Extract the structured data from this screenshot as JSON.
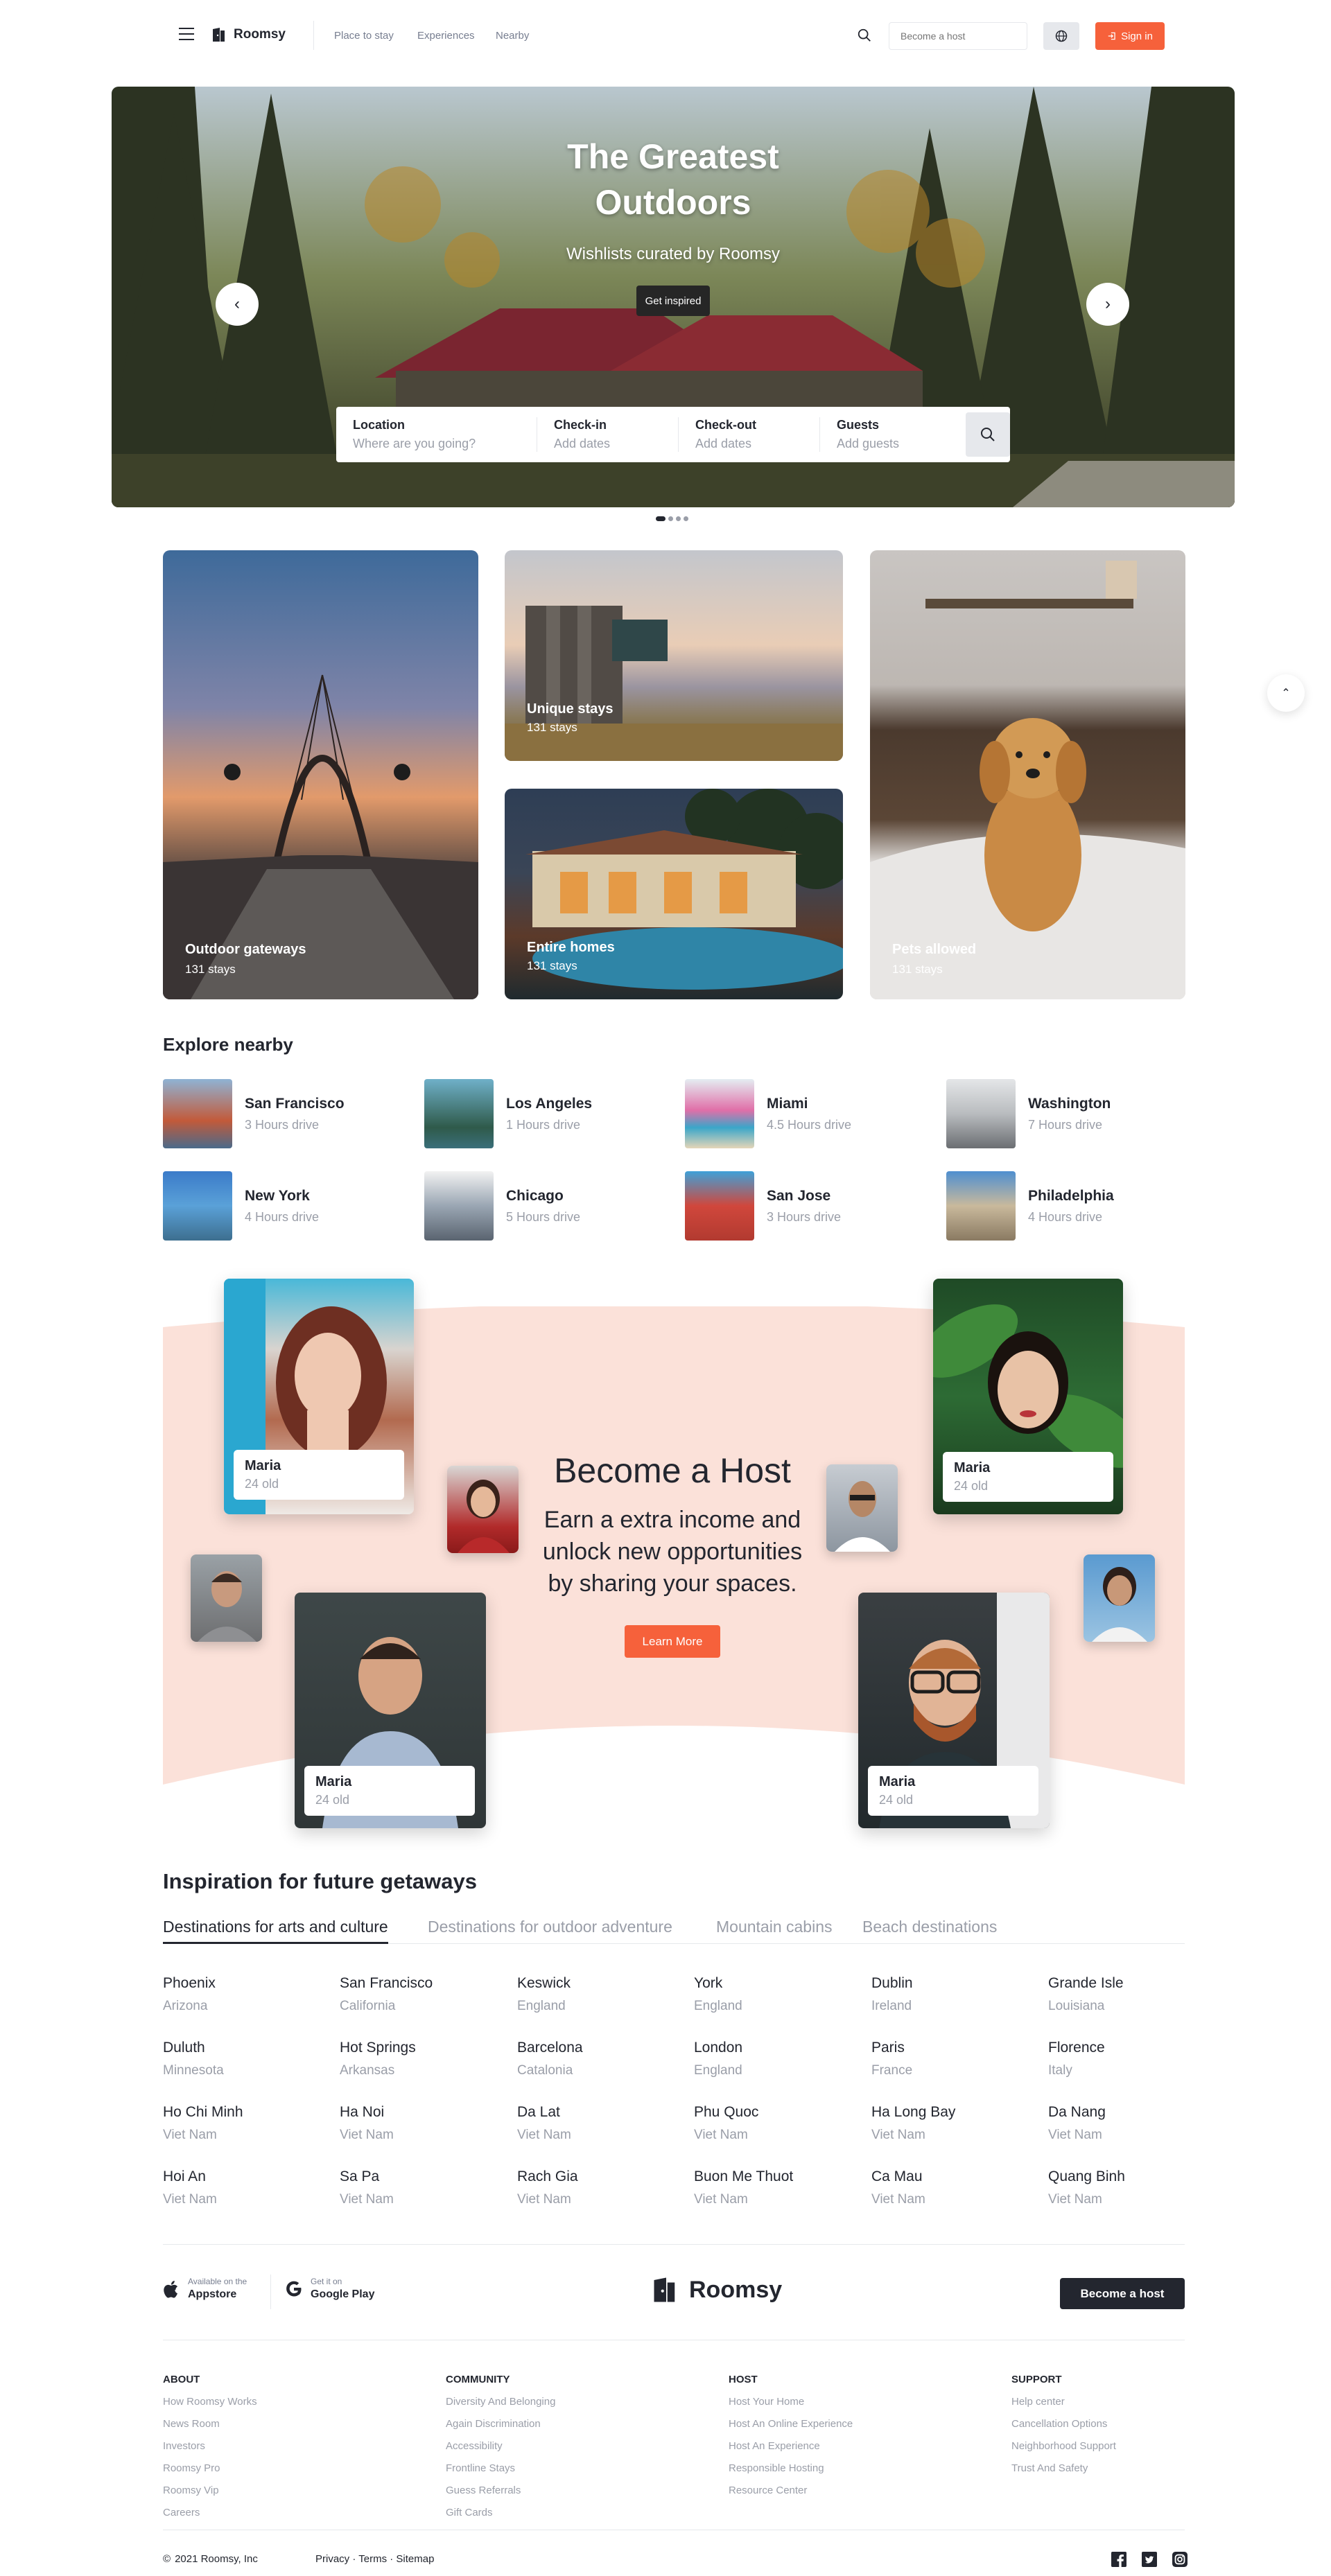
{
  "header": {
    "brand": "Roomsy",
    "nav": [
      "Place to stay",
      "Experiences",
      "Nearby"
    ],
    "host_placeholder": "Become a host",
    "signin_label": "Sign in",
    "accent": "#f6613b"
  },
  "hero": {
    "title_line1": "The Greatest",
    "title_line2": "Outdoors",
    "subtitle": "Wishlists curated by Roomsy",
    "cta": "Get inspired",
    "active_slide": 1,
    "slide_count": 4,
    "search": {
      "location_label": "Location",
      "location_placeholder": "Where are you going?",
      "checkin_label": "Check-in",
      "checkin_placeholder": "Add dates",
      "checkout_label": "Check-out",
      "checkout_placeholder": "Add dates",
      "guests_label": "Guests",
      "guests_placeholder": "Add guests"
    }
  },
  "categories": [
    {
      "title": "Outdoor gateways",
      "count": "131 stays"
    },
    {
      "title": "Unique stays",
      "count": "131 stays"
    },
    {
      "title": "Entire homes",
      "count": "131 stays"
    },
    {
      "title": "Pets allowed",
      "count": "131 stays"
    }
  ],
  "explore": {
    "title": "Explore nearby",
    "items": [
      {
        "city": "San Francisco",
        "drive": "3 Hours drive"
      },
      {
        "city": "Los Angeles",
        "drive": "1 Hours drive"
      },
      {
        "city": "Miami",
        "drive": "4.5 Hours drive"
      },
      {
        "city": "Washington",
        "drive": "7 Hours drive"
      },
      {
        "city": "New York",
        "drive": "4 Hours drive"
      },
      {
        "city": "Chicago",
        "drive": "5 Hours drive"
      },
      {
        "city": "San Jose",
        "drive": "3 Hours drive"
      },
      {
        "city": "Philadelphia",
        "drive": "4 Hours drive"
      }
    ]
  },
  "host": {
    "title": "Become a Host",
    "text_line1": "Earn a extra income and",
    "text_line2": "unlock new opportunities",
    "text_line3": "by sharing your spaces.",
    "cta": "Learn More",
    "people": [
      {
        "name": "Maria",
        "age": "24 old"
      },
      {
        "name": "Maria",
        "age": "24 old"
      },
      {
        "name": "Maria",
        "age": "24 old"
      },
      {
        "name": "Maria",
        "age": "24 old"
      }
    ]
  },
  "inspiration": {
    "title": "Inspiration for future getaways",
    "tabs": [
      "Destinations for arts and culture",
      "Destinations for outdoor adventure",
      "Mountain cabins",
      "Beach destinations"
    ],
    "rows": [
      [
        {
          "c": "Phoenix",
          "r": "Arizona"
        },
        {
          "c": "San Francisco",
          "r": "California"
        },
        {
          "c": "Keswick",
          "r": "England"
        },
        {
          "c": "York",
          "r": "England"
        },
        {
          "c": "Dublin",
          "r": "Ireland"
        },
        {
          "c": "Grande Isle",
          "r": "Louisiana"
        }
      ],
      [
        {
          "c": "Duluth",
          "r": "Minnesota"
        },
        {
          "c": "Hot Springs",
          "r": "Arkansas"
        },
        {
          "c": "Barcelona",
          "r": "Catalonia"
        },
        {
          "c": "London",
          "r": "England"
        },
        {
          "c": "Paris",
          "r": "France"
        },
        {
          "c": "Florence",
          "r": "Italy"
        }
      ],
      [
        {
          "c": "Ho Chi Minh",
          "r": "Viet Nam"
        },
        {
          "c": "Ha Noi",
          "r": "Viet Nam"
        },
        {
          "c": "Da Lat",
          "r": "Viet Nam"
        },
        {
          "c": "Phu Quoc",
          "r": "Viet Nam"
        },
        {
          "c": "Ha Long Bay",
          "r": "Viet Nam"
        },
        {
          "c": "Da Nang",
          "r": "Viet Nam"
        }
      ],
      [
        {
          "c": "Hoi An",
          "r": "Viet Nam"
        },
        {
          "c": "Sa Pa",
          "r": "Viet Nam"
        },
        {
          "c": "Rach Gia",
          "r": "Viet Nam"
        },
        {
          "c": "Buon Me Thuot",
          "r": "Viet Nam"
        },
        {
          "c": "Ca Mau",
          "r": "Viet Nam"
        },
        {
          "c": "Quang Binh",
          "r": "Viet Nam"
        }
      ]
    ]
  },
  "footer": {
    "appstore_small": "Available on the",
    "appstore": "Appstore",
    "gplay_small": "Get it on",
    "gplay": "Google Play",
    "brand": "Roomsy",
    "host_btn": "Become a host",
    "columns": [
      {
        "head": "ABOUT",
        "links": [
          "How Roomsy Works",
          "News Room",
          "Investors",
          "Roomsy Pro",
          "Roomsy Vip",
          "Careers"
        ]
      },
      {
        "head": "COMMUNITY",
        "links": [
          "Diversity And Belonging",
          "Again Discrimination",
          "Accessibility",
          "Frontline Stays",
          "Guess Referrals",
          "Gift Cards"
        ]
      },
      {
        "head": "HOST",
        "links": [
          "Host Your Home",
          "Host An Online Experience",
          "Host An Experience",
          "Responsible Hosting",
          "Resource Center"
        ]
      },
      {
        "head": "SUPPORT",
        "links": [
          "Help center",
          "Cancellation Options",
          "Neighborhood Support",
          "Trust And Safety"
        ]
      }
    ],
    "copyright": "2021 Roomsy, Inc",
    "legal": "Privacy · Terms · Sitemap"
  }
}
